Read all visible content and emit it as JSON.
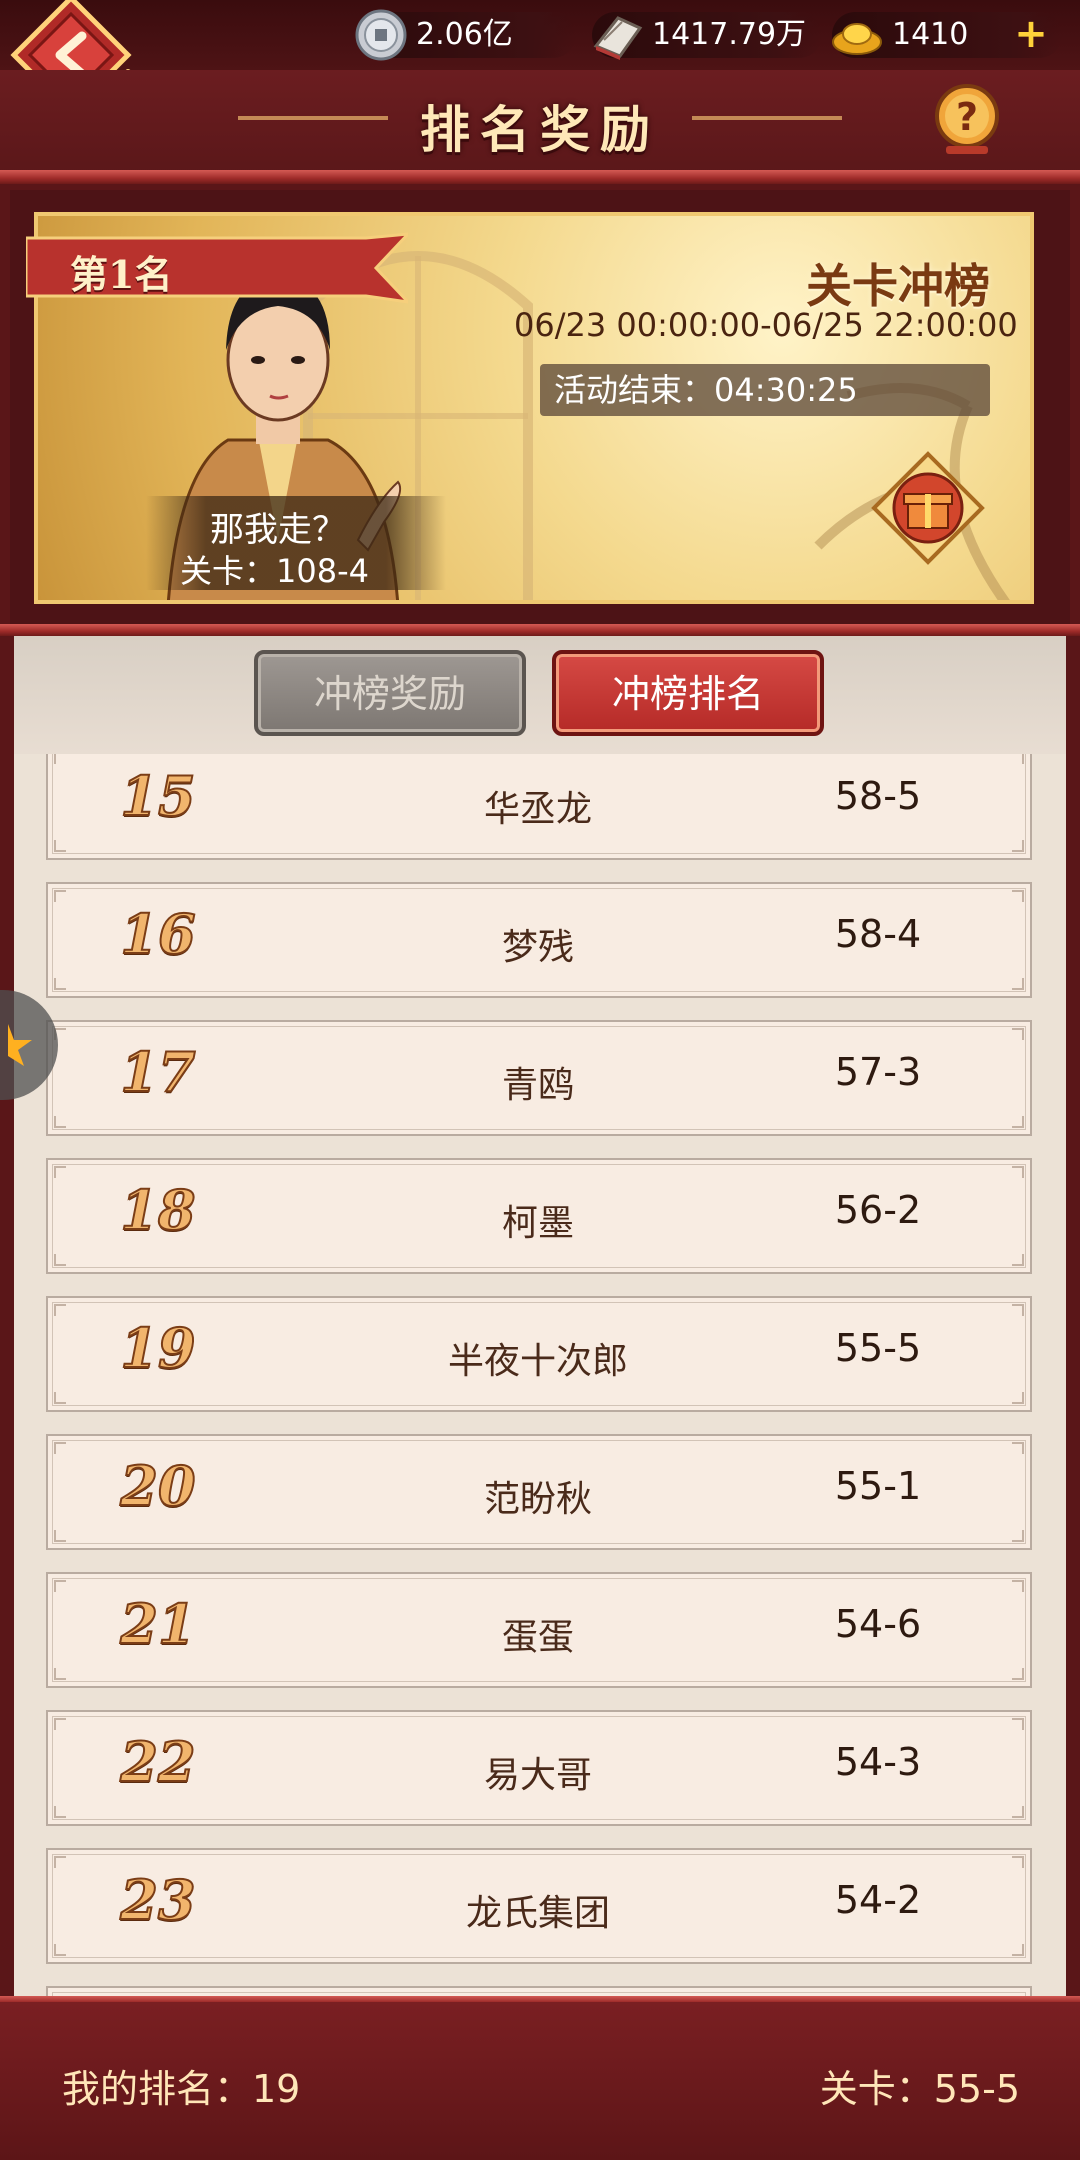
{
  "resources": [
    {
      "icon": "silver-coin-icon",
      "value": "2.06亿"
    },
    {
      "icon": "book-icon",
      "value": "1417.79万"
    },
    {
      "icon": "gold-ingot-icon",
      "value": "1410"
    }
  ],
  "header": {
    "title": "排名奖励"
  },
  "banner": {
    "rank_label": "第1名",
    "event_name": "关卡冲榜",
    "time_range": "06/23  00:00:00-06/25  22:00:00",
    "countdown": "活动结束：04:30:25",
    "character_name": "那我走？",
    "character_stage": "关卡：108-4"
  },
  "tabs": [
    {
      "label": "冲榜奖励",
      "active": false
    },
    {
      "label": "冲榜排名",
      "active": true
    }
  ],
  "rankings": [
    {
      "rank": "15",
      "name": "华丞龙",
      "stage": "58-5"
    },
    {
      "rank": "16",
      "name": "梦残",
      "stage": "58-4"
    },
    {
      "rank": "17",
      "name": "青鸥",
      "stage": "57-3"
    },
    {
      "rank": "18",
      "name": "柯墨",
      "stage": "56-2"
    },
    {
      "rank": "19",
      "name": "半夜十次郎",
      "stage": "55-5"
    },
    {
      "rank": "20",
      "name": "范盼秋",
      "stage": "55-1"
    },
    {
      "rank": "21",
      "name": "蛋蛋",
      "stage": "54-6"
    },
    {
      "rank": "22",
      "name": "易大哥",
      "stage": "54-3"
    },
    {
      "rank": "23",
      "name": "龙氏集团",
      "stage": "54-2"
    }
  ],
  "footer": {
    "my_rank": "我的排名：19",
    "my_stage": "关卡：55-5"
  },
  "colors": {
    "accent_red": "#b52a27",
    "gold": "#f1b56d",
    "background": "#5a1618"
  }
}
